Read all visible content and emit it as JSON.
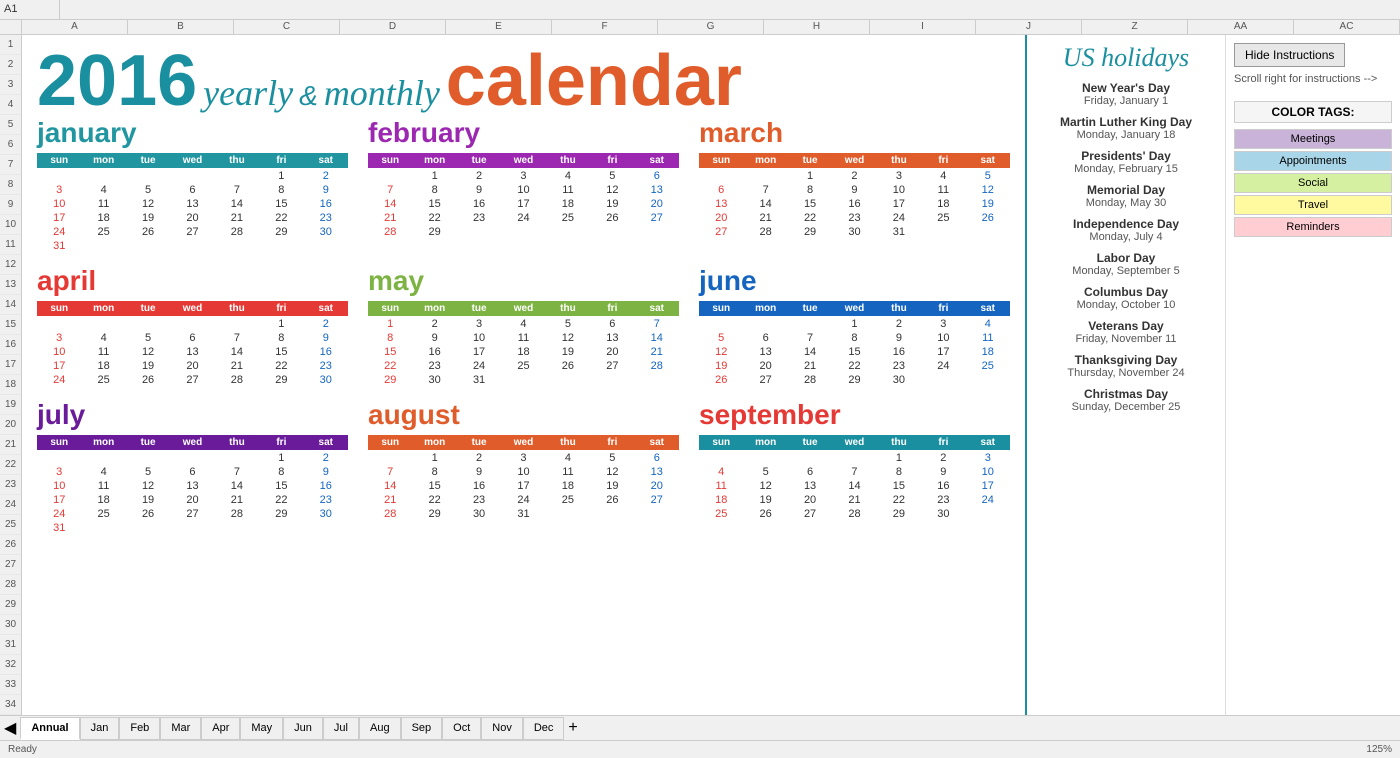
{
  "title": {
    "year": "2016",
    "yearly": "yearly",
    "amp": "&",
    "monthly": "monthly",
    "calendar": "calendar"
  },
  "months": [
    {
      "name": "january",
      "colorClass": "jan",
      "headerClass": "hdr-jan",
      "days": [
        [
          "",
          "",
          "",
          "",
          "",
          "1",
          "2"
        ],
        [
          "3",
          "4",
          "5",
          "6",
          "7",
          "8",
          "9"
        ],
        [
          "10",
          "11",
          "12",
          "13",
          "14",
          "15",
          "16"
        ],
        [
          "17",
          "18",
          "19",
          "20",
          "21",
          "22",
          "23"
        ],
        [
          "24",
          "25",
          "26",
          "27",
          "28",
          "29",
          "30"
        ],
        [
          "31",
          "",
          "",
          "",
          "",
          "",
          ""
        ]
      ]
    },
    {
      "name": "february",
      "colorClass": "feb",
      "headerClass": "hdr-feb",
      "days": [
        [
          "",
          "1",
          "2",
          "3",
          "4",
          "5",
          "6"
        ],
        [
          "7",
          "8",
          "9",
          "10",
          "11",
          "12",
          "13"
        ],
        [
          "14",
          "15",
          "16",
          "17",
          "18",
          "19",
          "20"
        ],
        [
          "21",
          "22",
          "23",
          "24",
          "25",
          "26",
          "27"
        ],
        [
          "28",
          "29",
          "",
          "",
          "",
          "",
          ""
        ]
      ]
    },
    {
      "name": "march",
      "colorClass": "mar",
      "headerClass": "hdr-mar",
      "days": [
        [
          "",
          "",
          "1",
          "2",
          "3",
          "4",
          "5"
        ],
        [
          "6",
          "7",
          "8",
          "9",
          "10",
          "11",
          "12"
        ],
        [
          "13",
          "14",
          "15",
          "16",
          "17",
          "18",
          "19"
        ],
        [
          "20",
          "21",
          "22",
          "23",
          "24",
          "25",
          "26"
        ],
        [
          "27",
          "28",
          "29",
          "30",
          "31",
          "",
          ""
        ]
      ]
    },
    {
      "name": "april",
      "colorClass": "apr",
      "headerClass": "hdr-apr",
      "days": [
        [
          "",
          "",
          "",
          "",
          "",
          "1",
          "2"
        ],
        [
          "3",
          "4",
          "5",
          "6",
          "7",
          "8",
          "9"
        ],
        [
          "10",
          "11",
          "12",
          "13",
          "14",
          "15",
          "16"
        ],
        [
          "17",
          "18",
          "19",
          "20",
          "21",
          "22",
          "23"
        ],
        [
          "24",
          "25",
          "26",
          "27",
          "28",
          "29",
          "30"
        ]
      ]
    },
    {
      "name": "may",
      "colorClass": "may",
      "headerClass": "hdr-may",
      "days": [
        [
          "1",
          "2",
          "3",
          "4",
          "5",
          "6",
          "7"
        ],
        [
          "8",
          "9",
          "10",
          "11",
          "12",
          "13",
          "14"
        ],
        [
          "15",
          "16",
          "17",
          "18",
          "19",
          "20",
          "21"
        ],
        [
          "22",
          "23",
          "24",
          "25",
          "26",
          "27",
          "28"
        ],
        [
          "29",
          "30",
          "31",
          "",
          "",
          "",
          ""
        ]
      ]
    },
    {
      "name": "june",
      "colorClass": "jun",
      "headerClass": "hdr-jun",
      "days": [
        [
          "",
          "",
          "",
          "1",
          "2",
          "3",
          "4"
        ],
        [
          "5",
          "6",
          "7",
          "8",
          "9",
          "10",
          "11"
        ],
        [
          "12",
          "13",
          "14",
          "15",
          "16",
          "17",
          "18"
        ],
        [
          "19",
          "20",
          "21",
          "22",
          "23",
          "24",
          "25"
        ],
        [
          "26",
          "27",
          "28",
          "29",
          "30",
          "",
          ""
        ]
      ]
    },
    {
      "name": "july",
      "colorClass": "jul",
      "headerClass": "hdr-jul",
      "days": [
        [
          "",
          "",
          "",
          "",
          "",
          "1",
          "2"
        ],
        [
          "3",
          "4",
          "5",
          "6",
          "7",
          "8",
          "9"
        ],
        [
          "10",
          "11",
          "12",
          "13",
          "14",
          "15",
          "16"
        ],
        [
          "17",
          "18",
          "19",
          "20",
          "21",
          "22",
          "23"
        ],
        [
          "24",
          "25",
          "26",
          "27",
          "28",
          "29",
          "30"
        ],
        [
          "31",
          "",
          "",
          "",
          "",
          "",
          ""
        ]
      ]
    },
    {
      "name": "august",
      "colorClass": "aug",
      "headerClass": "hdr-aug",
      "days": [
        [
          "",
          "1",
          "2",
          "3",
          "4",
          "5",
          "6"
        ],
        [
          "7",
          "8",
          "9",
          "10",
          "11",
          "12",
          "13"
        ],
        [
          "14",
          "15",
          "16",
          "17",
          "18",
          "19",
          "20"
        ],
        [
          "21",
          "22",
          "23",
          "24",
          "25",
          "26",
          "27"
        ],
        [
          "28",
          "29",
          "30",
          "31",
          "",
          "",
          ""
        ]
      ]
    },
    {
      "name": "september",
      "colorClass": "sep",
      "headerClass": "hdr-sep",
      "days": [
        [
          "",
          "",
          "",
          "",
          "1",
          "2",
          "3"
        ],
        [
          "4",
          "5",
          "6",
          "7",
          "8",
          "9",
          "10"
        ],
        [
          "11",
          "12",
          "13",
          "14",
          "15",
          "16",
          "17"
        ],
        [
          "18",
          "19",
          "20",
          "21",
          "22",
          "23",
          "24"
        ],
        [
          "25",
          "26",
          "27",
          "28",
          "29",
          "30",
          ""
        ]
      ]
    }
  ],
  "dayHeaders": [
    "sun",
    "mon",
    "tue",
    "wed",
    "thu",
    "fri",
    "sat"
  ],
  "holidays": {
    "title": "US holidays",
    "items": [
      {
        "name": "New Year's Day",
        "date": "Friday, January 1"
      },
      {
        "name": "Martin Luther King Day",
        "date": "Monday, January 18"
      },
      {
        "name": "Presidents' Day",
        "date": "Monday, February 15"
      },
      {
        "name": "Memorial Day",
        "date": "Monday, May 30"
      },
      {
        "name": "Independence Day",
        "date": "Monday, July 4"
      },
      {
        "name": "Labor Day",
        "date": "Monday, September 5"
      },
      {
        "name": "Columbus Day",
        "date": "Monday, October 10"
      },
      {
        "name": "Veterans Day",
        "date": "Friday, November 11"
      },
      {
        "name": "Thanksgiving Day",
        "date": "Thursday, November 24"
      },
      {
        "name": "Christmas Day",
        "date": "Sunday, December 25"
      }
    ]
  },
  "colorTags": {
    "title": "COLOR TAGS:",
    "items": [
      {
        "label": "Meetings",
        "color": "#c9b3d9"
      },
      {
        "label": "Appointments",
        "color": "#a8d5e8"
      },
      {
        "label": "Social",
        "color": "#d4f0a0"
      },
      {
        "label": "Travel",
        "color": "#fff9a0"
      },
      {
        "label": "Reminders",
        "color": "#ffcdd2"
      }
    ]
  },
  "instructions": {
    "hide_label": "Hide Instructions",
    "scroll_text": "Scroll right for instructions -->"
  },
  "tabs": [
    "Annual",
    "Jan",
    "Feb",
    "Mar",
    "Apr",
    "May",
    "Jun",
    "Jul",
    "Aug",
    "Sep",
    "Oct",
    "Nov",
    "Dec"
  ],
  "status": {
    "ready": "Ready",
    "zoom": "125%"
  }
}
